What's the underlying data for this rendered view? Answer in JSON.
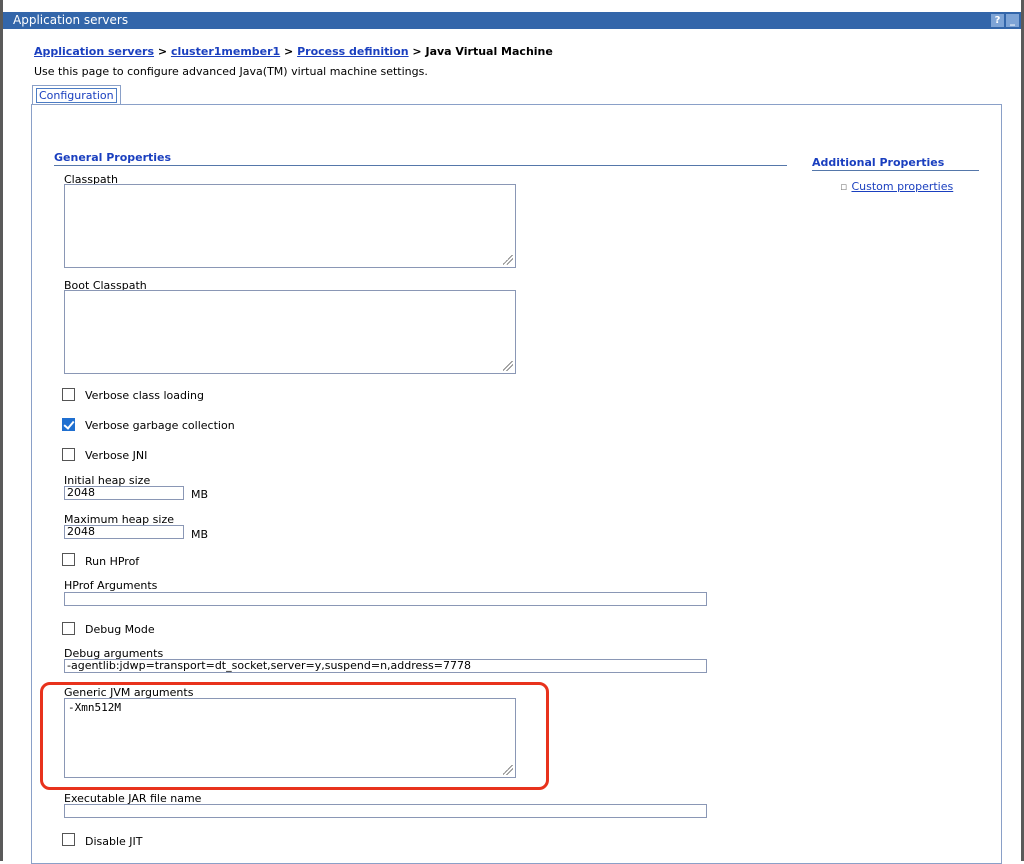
{
  "window": {
    "title": "Application servers",
    "help_btn": "?",
    "min_btn": "_"
  },
  "breadcrumb": {
    "items": [
      "Application servers",
      "cluster1member1",
      "Process definition"
    ],
    "separator": ">",
    "current": "Java Virtual Machine"
  },
  "description": "Use this page to configure advanced Java(TM) virtual machine settings.",
  "tabs": [
    "Configuration"
  ],
  "general_properties": {
    "heading": "General Properties",
    "classpath": {
      "label": "Classpath",
      "value": ""
    },
    "boot_classpath": {
      "label": "Boot Classpath",
      "value": ""
    },
    "verbose_class_loading": {
      "label": "Verbose class loading",
      "checked": false
    },
    "verbose_gc": {
      "label": "Verbose garbage collection",
      "checked": true
    },
    "verbose_jni": {
      "label": "Verbose JNI",
      "checked": false
    },
    "initial_heap": {
      "label": "Initial heap size",
      "value": "2048",
      "unit": "MB"
    },
    "max_heap": {
      "label": "Maximum heap size",
      "value": "2048",
      "unit": "MB"
    },
    "run_hprof": {
      "label": "Run HProf",
      "checked": false
    },
    "hprof_args": {
      "label": "HProf Arguments",
      "value": ""
    },
    "debug_mode": {
      "label": "Debug Mode",
      "checked": false
    },
    "debug_args": {
      "label": "Debug arguments",
      "value": "-agentlib:jdwp=transport=dt_socket,server=y,suspend=n,address=7778"
    },
    "generic_jvm_args": {
      "label": "Generic JVM arguments",
      "value": "-Xmn512M"
    },
    "exec_jar": {
      "label": "Executable JAR file name",
      "value": ""
    },
    "disable_jit": {
      "label": "Disable JIT",
      "checked": false
    }
  },
  "additional_properties": {
    "heading": "Additional Properties",
    "links": [
      "Custom properties"
    ]
  },
  "colors": {
    "title_bar": "#3366aa",
    "link": "#1a3fbf",
    "highlight": "#e8321c",
    "checkbox_checked": "#1f6fd0"
  }
}
